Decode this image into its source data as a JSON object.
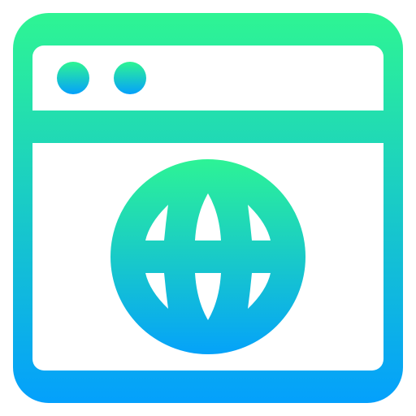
{
  "icon": {
    "name": "browser-globe-icon",
    "gradient_top": "#2EF593",
    "gradient_bottom": "#04A0FC",
    "background": "#FFFFFF"
  }
}
